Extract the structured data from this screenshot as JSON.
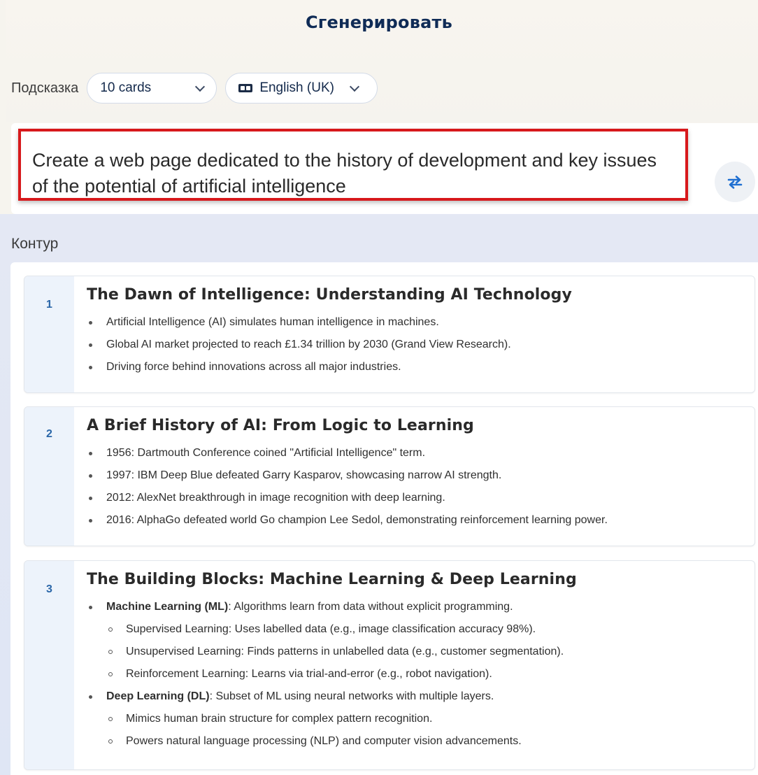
{
  "header": {
    "title": "Сгенерировать"
  },
  "prompt_controls": {
    "label": "Подсказка",
    "cards_select": "10 cards",
    "language_select": "English (UK)"
  },
  "prompt": {
    "text": "Create a web page dedicated to the history of development and key issues of the potential of artificial intelligence"
  },
  "outline": {
    "label": "Контур",
    "cards": [
      {
        "number": "1",
        "title": "The Dawn of Intelligence: Understanding AI Technology",
        "bullets": [
          "Artificial Intelligence (AI) simulates human intelligence in machines.",
          "Global AI market projected to reach £1.34 trillion by 2030 (Grand View Research).",
          "Driving force behind innovations across all major industries."
        ]
      },
      {
        "number": "2",
        "title": "A Brief History of AI: From Logic to Learning",
        "bullets": [
          "1956: Dartmouth Conference coined \"Artificial Intelligence\" term.",
          "1997: IBM Deep Blue defeated Garry Kasparov, showcasing narrow AI strength.",
          "2012: AlexNet breakthrough in image recognition with deep learning.",
          "2016: AlphaGo defeated world Go champion Lee Sedol, demonstrating reinforcement learning power."
        ]
      },
      {
        "number": "3",
        "title": "The Building Blocks: Machine Learning & Deep Learning",
        "ml_term": "Machine Learning (ML)",
        "ml_text": ": Algorithms learn from data without explicit programming.",
        "ml_sub": [
          "Supervised Learning: Uses labelled data (e.g., image classification accuracy 98%).",
          "Unsupervised Learning: Finds patterns in unlabelled data (e.g., customer segmentation).",
          "Reinforcement Learning: Learns via trial-and-error (e.g., robot navigation)."
        ],
        "dl_term": "Deep Learning (DL)",
        "dl_text": ": Subset of ML using neural networks with multiple layers.",
        "dl_sub": [
          "Mimics human brain structure for complex pattern recognition.",
          "Powers natural language processing (NLP) and computer vision advancements."
        ]
      }
    ]
  }
}
